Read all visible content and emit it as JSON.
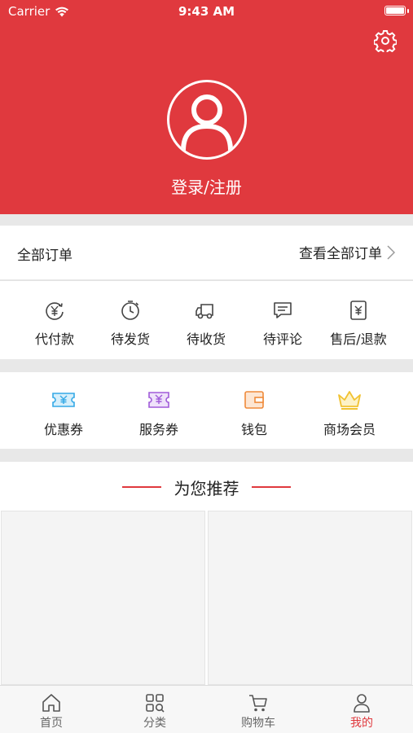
{
  "status_bar": {
    "carrier": "Carrier",
    "time": "9:43 AM"
  },
  "header": {
    "login_label": "登录/注册",
    "bg_color": "#e0393e"
  },
  "orders": {
    "title": "全部订单",
    "view_all": "查看全部订单"
  },
  "order_status": [
    {
      "label": "代付款",
      "icon": "yen-refresh-icon"
    },
    {
      "label": "待发货",
      "icon": "clock-icon"
    },
    {
      "label": "待收货",
      "icon": "truck-icon"
    },
    {
      "label": "待评论",
      "icon": "comment-icon"
    },
    {
      "label": "售后/退款",
      "icon": "refund-icon"
    }
  ],
  "services": [
    {
      "label": "优惠券",
      "icon": "coupon-icon",
      "color": "#35a9e6"
    },
    {
      "label": "服务券",
      "icon": "service-ticket-icon",
      "color": "#a05bd9"
    },
    {
      "label": "钱包",
      "icon": "wallet-icon",
      "color": "#ef8a3a"
    },
    {
      "label": "商场会员",
      "icon": "crown-icon",
      "color": "#f1c232"
    }
  ],
  "recommend": {
    "title": "为您推荐"
  },
  "tabbar": [
    {
      "label": "首页",
      "icon": "home-icon"
    },
    {
      "label": "分类",
      "icon": "category-icon"
    },
    {
      "label": "购物车",
      "icon": "cart-icon"
    },
    {
      "label": "我的",
      "icon": "user-icon",
      "active": true
    }
  ]
}
